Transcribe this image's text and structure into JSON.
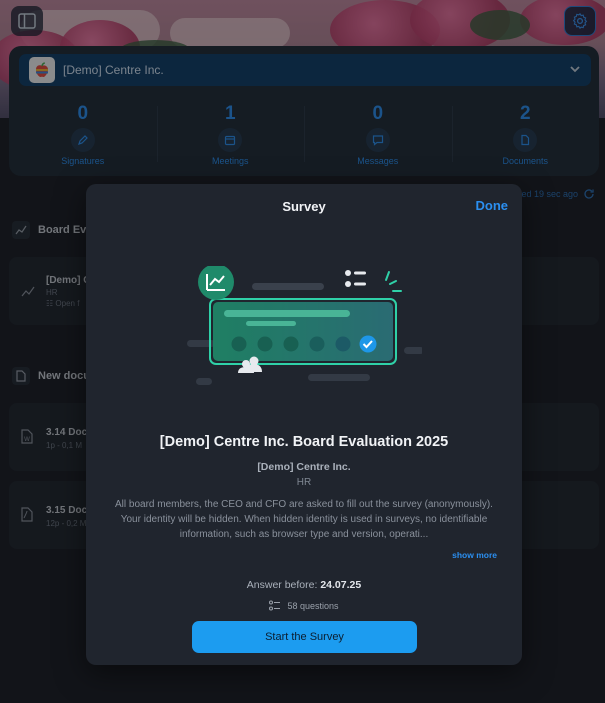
{
  "company": {
    "name": "[Demo] Centre Inc."
  },
  "stats": [
    {
      "value": "0",
      "label": "Signatures",
      "icon": "pen-icon"
    },
    {
      "value": "1",
      "label": "Meetings",
      "icon": "calendar-icon"
    },
    {
      "value": "0",
      "label": "Messages",
      "icon": "chat-icon"
    },
    {
      "value": "2",
      "label": "Documents",
      "icon": "document-icon"
    }
  ],
  "sync_status": "sed 19 sec ago",
  "background": {
    "board_section": "Board Eva",
    "board_item_title": "[Demo] C",
    "board_item_dept": "HR",
    "board_item_status": "Open f",
    "docs_section": "New docu",
    "doc1_title": "3.14 Doc",
    "doc1_meta": "1p - 0,1 M",
    "doc2_title": "3.15 Doc",
    "doc2_meta": "12p - 0,2 M"
  },
  "modal": {
    "title": "Survey",
    "done_label": "Done",
    "survey_title": "[Demo] Centre Inc. Board Evaluation 2025",
    "survey_company": "[Demo] Centre Inc.",
    "survey_department": "HR",
    "description": "All board members, the CEO and CFO are asked to fill out the survey (anonymously). Your identity will be hidden. When hidden identity is used in surveys, no identifiable information, such as browser type and version, operati...",
    "show_more": "show more",
    "answer_label": "Answer before:",
    "answer_date": "24.07.25",
    "question_count": "58 questions",
    "start_label": "Start the Survey"
  },
  "colors": {
    "accent": "#2b8ff0",
    "start_button": "#1c9cf0",
    "illustration_green": "#1f8a6a"
  }
}
